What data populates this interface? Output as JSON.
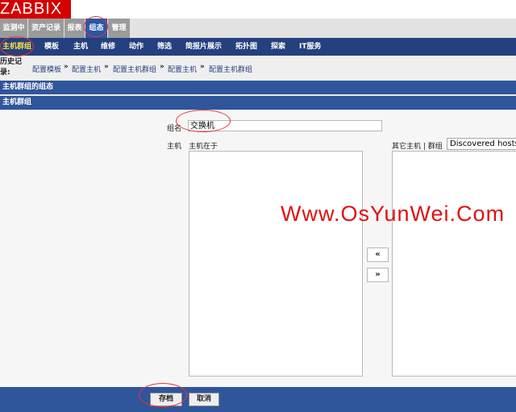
{
  "logo": {
    "text": "ZABBIX"
  },
  "main_menu": {
    "items": [
      {
        "label": "监测中"
      },
      {
        "label": "资产记录"
      },
      {
        "label": "报表"
      },
      {
        "label": "组态"
      },
      {
        "label": "管理"
      }
    ],
    "selected": "组态"
  },
  "sub_menu": {
    "items": [
      {
        "label": "主机群组"
      },
      {
        "label": "模板"
      },
      {
        "label": "主机"
      },
      {
        "label": "维修"
      },
      {
        "label": "动作"
      },
      {
        "label": "筛选"
      },
      {
        "label": "简报片展示"
      },
      {
        "label": "拓扑图"
      },
      {
        "label": "探索"
      },
      {
        "label": "IT服务"
      }
    ],
    "selected": "主机群组"
  },
  "history": {
    "label": "历史记录:",
    "crumbs": [
      "配置模板",
      "配置主机",
      "配置主机群组",
      "配置主机",
      "配置主机群组"
    ],
    "separator": "»"
  },
  "headers": {
    "section_title": "主机群组的组态",
    "form_title": "主机群组"
  },
  "form": {
    "group_name_label": "组名",
    "group_name_value": "交换机",
    "hosts_label": "主机",
    "hosts_in_label": "主机在于",
    "other_hosts_label": "其它主机 | 群组",
    "group_select_value": "Discovered hosts",
    "move_left_label": "«",
    "move_right_label": "»"
  },
  "buttons": {
    "save": "存档",
    "cancel": "取消"
  },
  "watermark": "Www.OsYunWei.Com",
  "colors": {
    "logo_bg": "#d40000",
    "main_menu_selected": "#2a56a5",
    "sub_menu_bg": "#24407e",
    "sub_menu_selected_text": "#ffdd44",
    "header_bar": "#2f559b",
    "annotation": "#ee3333"
  }
}
